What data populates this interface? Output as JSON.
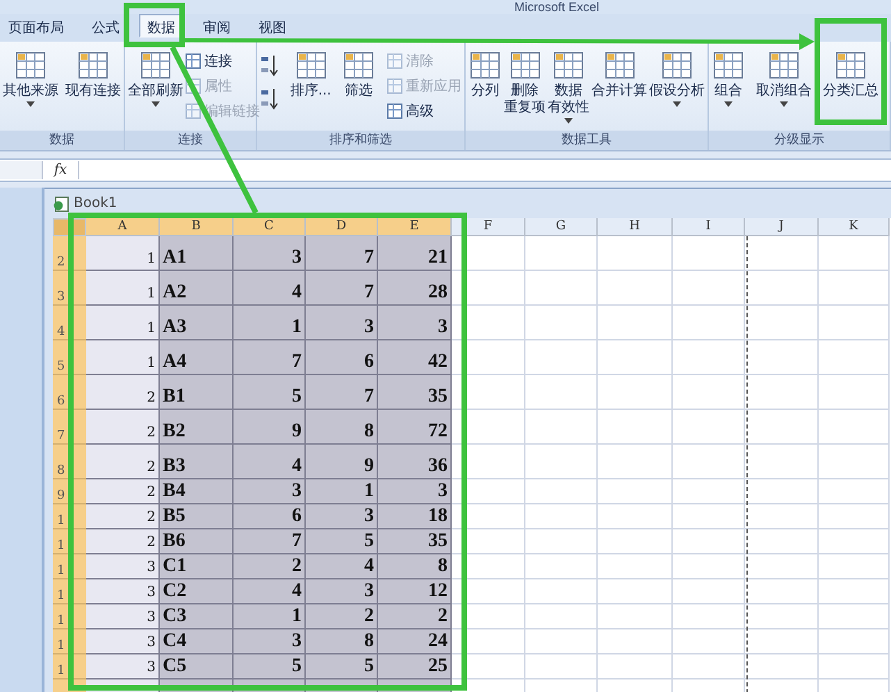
{
  "window": {
    "title": "Microsoft Excel"
  },
  "tabs": [
    {
      "label": "页面布局",
      "selected": false
    },
    {
      "label": "公式",
      "selected": false
    },
    {
      "label": "数据",
      "selected": true
    },
    {
      "label": "审阅",
      "selected": false
    },
    {
      "label": "视图",
      "selected": false
    }
  ],
  "ribbon": {
    "groups": [
      {
        "label": "数据",
        "buttons": [
          {
            "kind": "large",
            "lines": [
              "其他来源"
            ],
            "dropdown": true,
            "disabled": false
          },
          {
            "kind": "large",
            "lines": [
              "现有连接"
            ],
            "dropdown": false,
            "disabled": false
          }
        ]
      },
      {
        "label": "连接",
        "buttons": [
          {
            "kind": "large",
            "lines": [
              "全部刷新"
            ],
            "dropdown": true,
            "disabled": false
          },
          {
            "kind": "small",
            "label": "连接",
            "disabled": false
          },
          {
            "kind": "small",
            "label": "属性",
            "disabled": true
          },
          {
            "kind": "small",
            "label": "编辑链接",
            "disabled": true
          }
        ]
      },
      {
        "label": "排序和筛选",
        "buttons": [
          {
            "kind": "icon",
            "disabled": false
          },
          {
            "kind": "icon",
            "disabled": false
          },
          {
            "kind": "large",
            "lines": [
              "排序..."
            ],
            "dropdown": false,
            "disabled": false
          },
          {
            "kind": "large",
            "lines": [
              "筛选"
            ],
            "dropdown": false,
            "disabled": false
          },
          {
            "kind": "small",
            "label": "清除",
            "disabled": true
          },
          {
            "kind": "small",
            "label": "重新应用",
            "disabled": true
          },
          {
            "kind": "small",
            "label": "高级",
            "disabled": false
          }
        ]
      },
      {
        "label": "数据工具",
        "buttons": [
          {
            "kind": "large",
            "lines": [
              "分列"
            ],
            "dropdown": false,
            "disabled": false
          },
          {
            "kind": "large",
            "lines": [
              "删除",
              "重复项"
            ],
            "dropdown": false,
            "disabled": false
          },
          {
            "kind": "large",
            "lines": [
              "数据",
              "有效性"
            ],
            "dropdown": true,
            "disabled": false
          },
          {
            "kind": "large",
            "lines": [
              "合并计算"
            ],
            "dropdown": false,
            "disabled": false
          },
          {
            "kind": "large",
            "lines": [
              "假设分析"
            ],
            "dropdown": true,
            "disabled": false
          }
        ]
      },
      {
        "label": "分级显示",
        "buttons": [
          {
            "kind": "large",
            "lines": [
              "组合"
            ],
            "dropdown": true,
            "disabled": false
          },
          {
            "kind": "large",
            "lines": [
              "取消组合"
            ],
            "dropdown": true,
            "disabled": false
          },
          {
            "kind": "large",
            "lines": [
              "分类汇总"
            ],
            "dropdown": false,
            "disabled": false
          }
        ]
      }
    ]
  },
  "formula_bar": {
    "label": "fx"
  },
  "workbook": {
    "title": "Book1",
    "columns": [
      {
        "label": "A",
        "selected": true
      },
      {
        "label": "B",
        "selected": true
      },
      {
        "label": "C",
        "selected": true
      },
      {
        "label": "D",
        "selected": true
      },
      {
        "label": "E",
        "selected": true
      },
      {
        "label": "F",
        "selected": false
      },
      {
        "label": "G",
        "selected": false
      },
      {
        "label": "H",
        "selected": false
      },
      {
        "label": "I",
        "selected": false
      },
      {
        "label": "J",
        "selected": false
      },
      {
        "label": "K",
        "selected": false
      }
    ],
    "rows": [
      {
        "header": "2",
        "selected": true,
        "cells": [
          "1",
          "A1",
          "3",
          "7",
          "21"
        ]
      },
      {
        "header": "3",
        "selected": true,
        "cells": [
          "1",
          "A2",
          "4",
          "7",
          "28"
        ]
      },
      {
        "header": "4",
        "selected": true,
        "cells": [
          "1",
          "A3",
          "1",
          "3",
          "3"
        ]
      },
      {
        "header": "5",
        "selected": true,
        "cells": [
          "1",
          "A4",
          "7",
          "6",
          "42"
        ]
      },
      {
        "header": "6",
        "selected": true,
        "cells": [
          "2",
          "B1",
          "5",
          "7",
          "35"
        ]
      },
      {
        "header": "7",
        "selected": true,
        "cells": [
          "2",
          "B2",
          "9",
          "8",
          "72"
        ]
      },
      {
        "header": "8",
        "selected": true,
        "cells": [
          "2",
          "B3",
          "4",
          "9",
          "36"
        ]
      },
      {
        "header": "9",
        "selected": true,
        "cells": [
          "2",
          "B4",
          "3",
          "1",
          "3"
        ]
      },
      {
        "header": "1",
        "selected": true,
        "cells": [
          "2",
          "B5",
          "6",
          "3",
          "18"
        ]
      },
      {
        "header": "1",
        "selected": true,
        "cells": [
          "2",
          "B6",
          "7",
          "5",
          "35"
        ]
      },
      {
        "header": "1",
        "selected": true,
        "cells": [
          "3",
          "C1",
          "2",
          "4",
          "8"
        ]
      },
      {
        "header": "1",
        "selected": true,
        "cells": [
          "3",
          "C2",
          "4",
          "3",
          "12"
        ]
      },
      {
        "header": "1",
        "selected": true,
        "cells": [
          "3",
          "C3",
          "1",
          "2",
          "2"
        ]
      },
      {
        "header": "1",
        "selected": true,
        "cells": [
          "3",
          "C4",
          "3",
          "8",
          "24"
        ]
      },
      {
        "header": "1",
        "selected": true,
        "cells": [
          "3",
          "C5",
          "5",
          "5",
          "25"
        ]
      }
    ]
  }
}
